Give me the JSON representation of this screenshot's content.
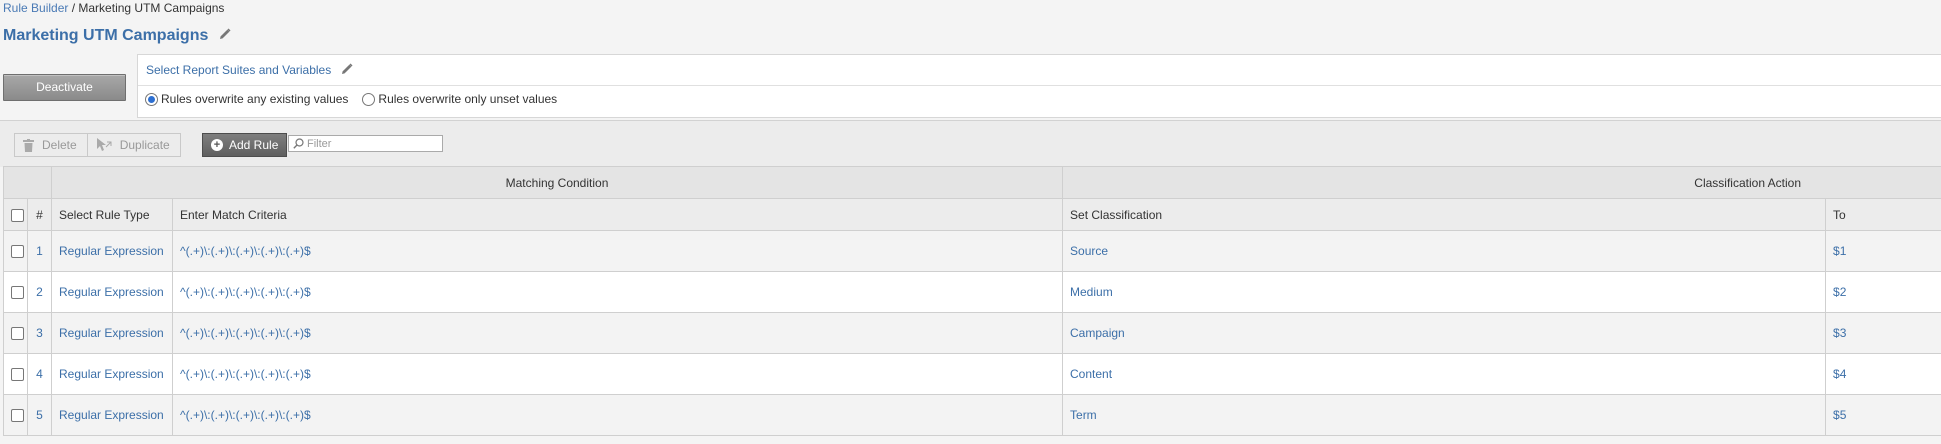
{
  "breadcrumb": {
    "root": "Rule Builder",
    "separator": " / ",
    "current": "Marketing UTM Campaigns"
  },
  "page": {
    "title": "Marketing UTM Campaigns"
  },
  "actions": {
    "deactivate_label": "Deactivate"
  },
  "settings": {
    "link_label": "Select Report Suites and Variables",
    "overwrite_options": [
      {
        "label": "Rules overwrite any existing values",
        "selected": true
      },
      {
        "label": "Rules overwrite only unset values",
        "selected": false
      }
    ]
  },
  "toolbar": {
    "delete_label": "Delete",
    "duplicate_label": "Duplicate",
    "add_rule_label": "Add Rule",
    "filter_placeholder": "Filter"
  },
  "table": {
    "group_headers": {
      "matching": "Matching Condition",
      "classification": "Classification Action"
    },
    "columns": {
      "num": "#",
      "rule_type": "Select Rule Type",
      "criteria": "Enter Match Criteria",
      "classification": "Set Classification",
      "to": "To"
    },
    "rows": [
      {
        "num": "1",
        "rule_type": "Regular Expression",
        "criteria": "^(.+)\\:(.+)\\:(.+)\\:(.+)\\:(.+)$",
        "classification": "Source",
        "to": "$1"
      },
      {
        "num": "2",
        "rule_type": "Regular Expression",
        "criteria": "^(.+)\\:(.+)\\:(.+)\\:(.+)\\:(.+)$",
        "classification": "Medium",
        "to": "$2"
      },
      {
        "num": "3",
        "rule_type": "Regular Expression",
        "criteria": "^(.+)\\:(.+)\\:(.+)\\:(.+)\\:(.+)$",
        "classification": "Campaign",
        "to": "$3"
      },
      {
        "num": "4",
        "rule_type": "Regular Expression",
        "criteria": "^(.+)\\:(.+)\\:(.+)\\:(.+)\\:(.+)$",
        "classification": "Content",
        "to": "$4"
      },
      {
        "num": "5",
        "rule_type": "Regular Expression",
        "criteria": "^(.+)\\:(.+)\\:(.+)\\:(.+)\\:(.+)$",
        "classification": "Term",
        "to": "$5"
      }
    ]
  },
  "colors": {
    "link": "#3c6fa8",
    "selected_radio": "#2d6fd1"
  },
  "icons": {
    "edit": "pencil-icon",
    "delete": "trash-icon",
    "duplicate": "duplicate-icon",
    "add": "plus-icon",
    "search": "search-icon"
  }
}
